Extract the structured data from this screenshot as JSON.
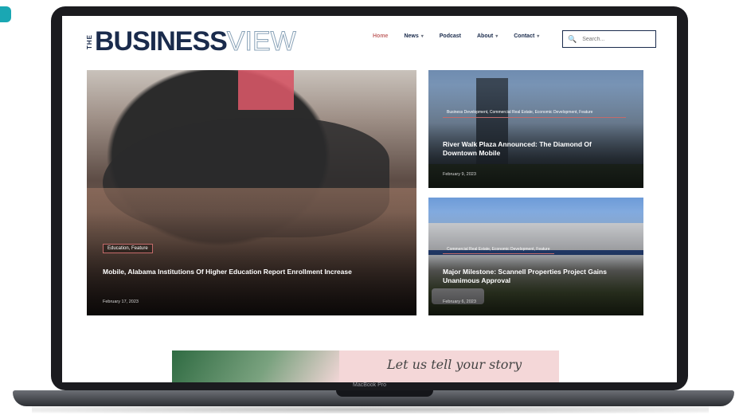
{
  "device": {
    "model_label": "MacBook Pro"
  },
  "site": {
    "logo": {
      "the": "THE",
      "main": "BUSINESS",
      "accent": "VIEW"
    },
    "nav": [
      {
        "label": "Home",
        "has_dropdown": false,
        "active": true
      },
      {
        "label": "News",
        "has_dropdown": true
      },
      {
        "label": "Podcast",
        "has_dropdown": false
      },
      {
        "label": "About",
        "has_dropdown": true
      },
      {
        "label": "Contact",
        "has_dropdown": true
      }
    ],
    "search": {
      "placeholder": "Search..."
    }
  },
  "articles": {
    "main": {
      "category": "Education, Feature",
      "title": "Mobile, Alabama Institutions Of Higher Education Report Enrollment Increase",
      "date": "February 17, 2023"
    },
    "side1": {
      "category": "Business Development, Commercial Real Estate, Economic Development, Feature",
      "title": "River Walk Plaza Announced: The Diamond Of Downtown Mobile",
      "date": "February 9, 2023"
    },
    "side2": {
      "category": "Commercial Real Estate, Economic Development, Feature",
      "title": "Major Milestone: Scannell Properties Project Gains Unanimous Approval",
      "date": "February 6, 2023"
    }
  },
  "ad": {
    "text": "Let us tell your story"
  },
  "colors": {
    "navy": "#1a2b4c",
    "accent_pink": "#c46a6a",
    "corner_teal": "#1aa7b3"
  }
}
